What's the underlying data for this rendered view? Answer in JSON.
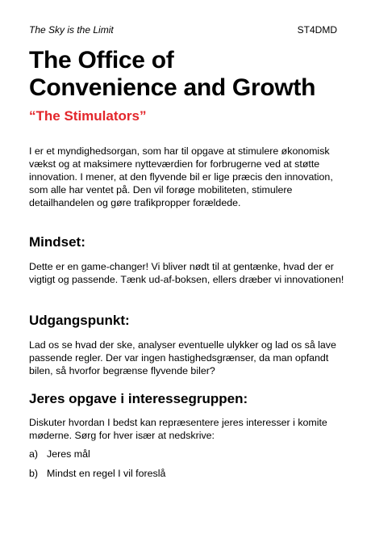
{
  "header": {
    "series": "The Sky is the Limit",
    "code": "ST4DMD"
  },
  "title": {
    "line1": "The Office of",
    "line2": "Convenience and Growth",
    "subtitle": "“The Stimulators”"
  },
  "intro": "I er et myndighedsorgan, som har til opgave at stimulere økonomisk vækst og at maksimere nytteværdien for forbrugerne ved at støtte innovation. I mener, at den flyvende bil er lige præcis den innovation, som alle har ventet på. Den vil forøge mobiliteten, stimulere detailhandelen og gøre trafikpropper forældede.",
  "sections": [
    {
      "heading": "Mindset:",
      "text": "Dette er en game-changer! Vi bliver nødt til at gentænke, hvad der er vigtigt og passende. Tænk ud-af-boksen, ellers dræber vi innovationen!"
    },
    {
      "heading": "Udgangspunkt:",
      "text": "Lad os se hvad der ske, analyser eventuelle ulykker og lad os så lave passende regler. Der var ingen hastighedsgrænser, da man opfandt bilen, så hvorfor begrænse flyvende biler?"
    },
    {
      "heading": "Jeres opgave i interessegruppen:",
      "text": "Diskuter hvordan I bedst kan repræsentere jeres interesser i komite møderne. Sørg for hver især at nedskrive:"
    }
  ],
  "list": [
    {
      "marker": "a)",
      "text": "Jeres mål"
    },
    {
      "marker": "b)",
      "text": "Mindst en regel I vil foreslå"
    }
  ],
  "colors": {
    "accent": "#e3262b",
    "text": "#000000",
    "background": "#ffffff"
  }
}
